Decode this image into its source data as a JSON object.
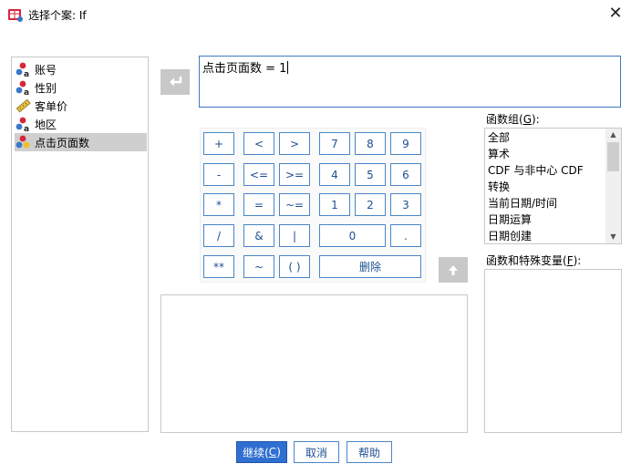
{
  "window": {
    "title": "选择个案: If",
    "close_glyph": "✕"
  },
  "variables": [
    {
      "label": "账号",
      "icon": "nominal-variable-icon",
      "selected": false
    },
    {
      "label": "性别",
      "icon": "nominal-variable-icon",
      "selected": false
    },
    {
      "label": "客单价",
      "icon": "scale-ruler-icon",
      "selected": false
    },
    {
      "label": "地区",
      "icon": "nominal-variable-icon",
      "selected": false
    },
    {
      "label": "点击页面数",
      "icon": "ordinal-variable-icon",
      "selected": true
    }
  ],
  "expression": {
    "text": "点击页面数 = 1"
  },
  "keypad": {
    "plus": "+",
    "lt": "<",
    "gt": ">",
    "seven": "7",
    "eight": "8",
    "nine": "9",
    "minus": "-",
    "le": "<=",
    "ge": ">=",
    "four": "4",
    "five": "5",
    "six": "6",
    "times": "*",
    "eq": "=",
    "ne": "~=",
    "one": "1",
    "two": "2",
    "three": "3",
    "divide": "/",
    "and": "&",
    "or": "|",
    "zero": "0",
    "dot": ".",
    "power": "**",
    "not": "~",
    "parens": "( )",
    "delete": "删除"
  },
  "function_group": {
    "label_prefix": "函数组(",
    "label_key": "G",
    "label_suffix": "):",
    "items": [
      "全部",
      "算术",
      "CDF 与非中心 CDF",
      "转换",
      "当前日期/时间",
      "日期运算",
      "日期创建"
    ]
  },
  "functions_special": {
    "label_prefix": "函数和特殊变量(",
    "label_key": "F",
    "label_suffix": "):"
  },
  "buttons": {
    "continue_prefix": "继续(",
    "continue_key": "C",
    "continue_suffix": ")",
    "cancel": "取消",
    "help": "帮助"
  },
  "colors": {
    "accent": "#2f6fcf",
    "key_border": "#4a86c8",
    "selection": "#cfcfcf"
  }
}
